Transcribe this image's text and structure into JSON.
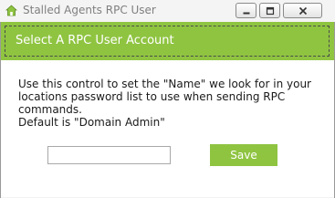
{
  "window": {
    "title": "Stalled Agents RPC User",
    "app_icon": "house-icon",
    "controls": [
      "minimize-icon",
      "maximize-icon",
      "close-icon"
    ]
  },
  "banner": {
    "title": "Select A RPC User Account",
    "color": "#8fc441"
  },
  "body": {
    "description": "Use this control to set the \"Name\" we look for in your locations password list to use when sending RPC commands.",
    "default_note": "Default is \"Domain Admin\""
  },
  "form": {
    "user_value": "",
    "save_label": "Save"
  }
}
